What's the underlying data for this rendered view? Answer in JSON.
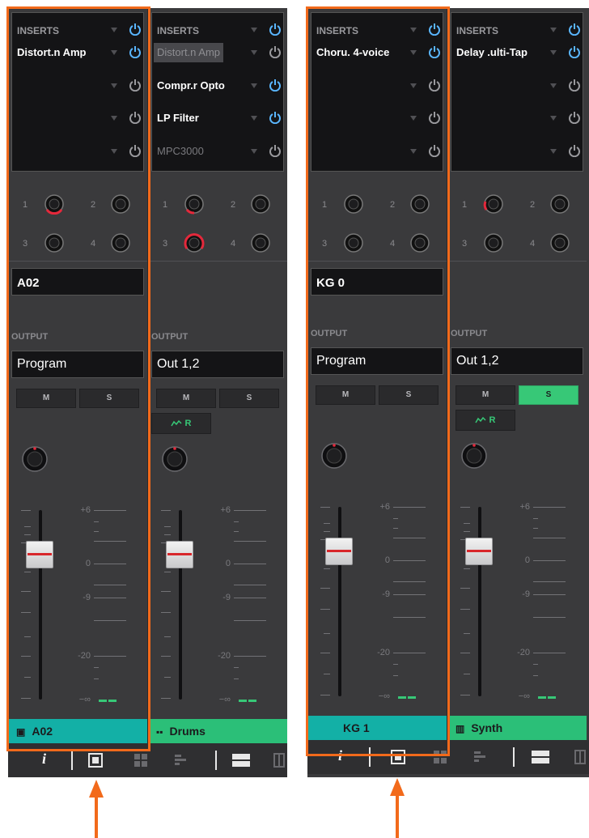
{
  "panel_left": {
    "strips": [
      {
        "inserts_header": "INSERTS",
        "inserts": [
          "Distort.n Amp",
          "",
          "",
          ""
        ],
        "name": "A02",
        "output_label": "OUTPUT",
        "output": "Program",
        "mute_label": "M",
        "solo_label": "S",
        "fader_scale": [
          "+6",
          "0",
          "-9",
          "-20",
          "−∞"
        ],
        "track_name": "A02",
        "track_color": "#13b0a6"
      },
      {
        "inserts_header": "INSERTS",
        "inserts": [
          "Distort.n Amp",
          "Compr.r Opto",
          "LP Filter",
          "MPC3000"
        ],
        "output_label": "OUTPUT",
        "output": "Out 1,2",
        "mute_label": "M",
        "solo_label": "S",
        "r_label": "R",
        "fader_scale": [
          "+6",
          "0",
          "-9",
          "-20",
          "−∞"
        ],
        "track_name": "Drums",
        "track_color": "#2bbf78"
      }
    ]
  },
  "panel_right": {
    "strips": [
      {
        "inserts_header": "INSERTS",
        "inserts": [
          "Choru. 4-voice",
          "",
          "",
          ""
        ],
        "name": "KG 0",
        "output_label": "OUTPUT",
        "output": "Program",
        "mute_label": "M",
        "solo_label": "S",
        "fader_scale": [
          "+6",
          "0",
          "-9",
          "-20",
          "−∞"
        ],
        "track_name": "KG 1",
        "track_color": "#13b0a6"
      },
      {
        "inserts_header": "INSERTS",
        "inserts": [
          "Delay .ulti-Tap",
          "",
          "",
          ""
        ],
        "output_label": "OUTPUT",
        "output": "Out 1,2",
        "mute_label": "M",
        "solo_label": "S",
        "r_label": "R",
        "fader_scale": [
          "+6",
          "0",
          "-9",
          "-20",
          "−∞"
        ],
        "track_name": "Synth",
        "track_color": "#2bbf78"
      }
    ]
  },
  "send_numbers": [
    "1",
    "2",
    "3",
    "4"
  ],
  "toolbar_info_label": "i",
  "colors": {
    "highlight": "#f26a1b",
    "power_on": "#5ab6ff",
    "power_off": "#9a9a9e",
    "send_active": "#e5283b",
    "meter": "#37c877"
  },
  "icons": [
    "power-icon",
    "info-icon",
    "single-view-icon",
    "grid-view-icon",
    "bars-view-icon",
    "strip-view-icon",
    "piano-icon",
    "pad-grid-icon",
    "dropdown-arrow-icon"
  ]
}
